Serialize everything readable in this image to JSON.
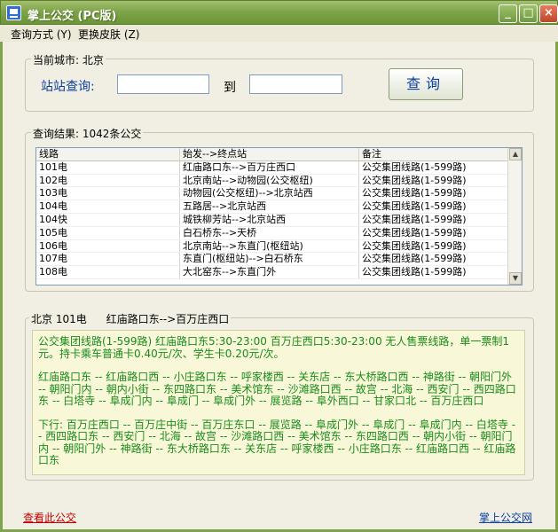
{
  "window": {
    "title": "掌上公交 (PC版)",
    "minimize": "_",
    "maximize": "□",
    "close": "×"
  },
  "menu": {
    "item1": "查询方式 (Y)",
    "item2": "更换皮肤 (Z)"
  },
  "search": {
    "group_label": "当前城市: 北京",
    "station_label": "站站查询:",
    "to_label": "到",
    "from_value": "",
    "to_value": "",
    "button_label": "查询"
  },
  "results": {
    "group_label": "查询结果: 1042条公交",
    "columns": [
      "线路",
      "始发-->终点站",
      "备注"
    ],
    "rows": [
      [
        "101电",
        "红庙路口东-->百万庄西口",
        "公交集团线路(1-599路)"
      ],
      [
        "102电",
        "北京南站-->动物园(公交枢纽)",
        "公交集团线路(1-599路)"
      ],
      [
        "103电",
        "动物园(公交枢纽)-->北京站西",
        "公交集团线路(1-599路)"
      ],
      [
        "104电",
        "五路居-->北京站西",
        "公交集团线路(1-599路)"
      ],
      [
        "104快",
        "城铁柳芳站-->北京站西",
        "公交集团线路(1-599路)"
      ],
      [
        "105电",
        "白石桥东-->天桥",
        "公交集团线路(1-599路)"
      ],
      [
        "106电",
        "北京南站-->东直门(枢纽站)",
        "公交集团线路(1-599路)"
      ],
      [
        "107电",
        "东直门(枢纽站)-->白石桥东",
        "公交集团线路(1-599路)"
      ],
      [
        "108电",
        "大北窑东-->东直门外",
        "公交集团线路(1-599路)"
      ]
    ]
  },
  "detail": {
    "header_city": "北京 101电",
    "header_route": "红庙路口东-->百万庄西口",
    "info": "公交集团线路(1-599路)    红庙路口东5:30-23:00 百万庄西口5:30-23:00    无人售票线路，单一票制1元。持卡乘车普通卡0.40元/次、学生卡0.20元/次。",
    "up": "红庙路口东 -- 红庙路口西 -- 小庄路口东 -- 呼家楼西 -- 关东店 -- 东大桥路口西 -- 神路街 -- 朝阳门外 -- 朝阳门内 -- 朝内小街 -- 东四路口东 -- 美术馆东 -- 沙滩路口西 -- 故宫 -- 北海 -- 西安门 -- 西四路口东 -- 白塔寺 -- 阜成门内 -- 阜成门 -- 阜成门外 -- 展览路 -- 阜外西口 -- 甘家口北 -- 百万庄西口",
    "down": "下行:     百万庄西口 -- 百万庄中街 -- 百万庄东口 -- 展览路 -- 阜成门外 -- 阜成门 -- 阜成门内 -- 白塔寺 -- 西四路口东 -- 西安门 -- 北海 -- 故宫 -- 沙滩路口西 -- 美术馆东 -- 东四路口西 -- 朝内小街 -- 朝阳门内 -- 朝阳门外 -- 神路街 -- 东大桥路口东 -- 关东店 -- 呼家楼西 -- 小庄路口东 -- 红庙路口西 -- 红庙路口东"
  },
  "footer": {
    "left_link": "查看此公交",
    "right_link": "掌上公交网"
  },
  "colors": {
    "title_bar": "#7fa44b",
    "accent_text": "#0b3fa0",
    "detail_text": "#1a8a1a",
    "left_link": "#c00000"
  }
}
